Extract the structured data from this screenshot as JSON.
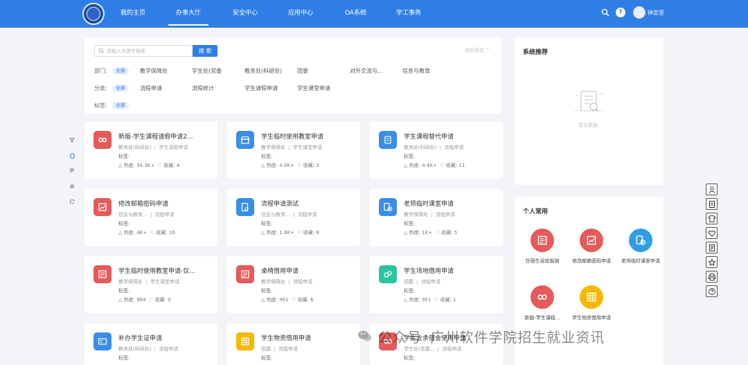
{
  "nav": {
    "items": [
      "我的主页",
      "办事大厅",
      "安全中心",
      "应用中心",
      "OA系统",
      "学工事务"
    ],
    "active_index": 1,
    "help_symbol": "?",
    "user_name": "钟志坚"
  },
  "left_icons": [
    "filter-icon",
    "home-icon",
    "list-icon",
    "hash-icon",
    "refresh-icon"
  ],
  "filter": {
    "search_placeholder": "请输入关键字搜索",
    "search_button": "搜 索",
    "collapse_link": "收起筛选 ^",
    "rows": [
      {
        "label": "部门:",
        "all": "全部",
        "options": [
          "教学保障处",
          "学生处(党委",
          "教务处(科研处)",
          "团委",
          "对外交流与...",
          "信息与教育"
        ]
      },
      {
        "label": "分类:",
        "all": "全部",
        "options": [
          "流程申请",
          "流程统计",
          "学生请假申请",
          "学生课堂申请"
        ]
      },
      {
        "label": "标签:",
        "all": "全部",
        "options": []
      }
    ]
  },
  "cards": [
    {
      "title": "新版-学生课程请假申请2...",
      "dept": "教务处(科研处)",
      "category": "学生请假申请",
      "tags_label": "标签:",
      "heat_label": "热度:",
      "heat": "54.3K+",
      "fav_label": "收藏:",
      "fav": "4",
      "color": "#e55a5a",
      "icon": "infinity-icon"
    },
    {
      "title": "学生临时使用教室申请",
      "dept": "教学保障处",
      "category": "学生课堂申请",
      "tags_label": "标签:",
      "heat_label": "热度:",
      "heat": "4.9K+",
      "fav_label": "收藏:",
      "fav": "3",
      "color": "#3a8ee6",
      "icon": "store-icon"
    },
    {
      "title": "学生课程替代申请",
      "dept": "教务处(科研处)",
      "category": "流程申请",
      "tags_label": "标签:",
      "heat_label": "热度:",
      "heat": "4.4K+",
      "fav_label": "收藏:",
      "fav": "11",
      "color": "#3a8ee6",
      "icon": "hand-icon"
    },
    {
      "title": "修改邮箱密码申请",
      "dept": "信息与教育...",
      "category": "流程申请",
      "tags_label": "标签:",
      "heat_label": "热度:",
      "heat": "4K+",
      "fav_label": "收藏:",
      "fav": "16",
      "color": "#e55a5a",
      "icon": "chart-icon"
    },
    {
      "title": "流程申请测试",
      "dept": "信息与教育...",
      "category": "流程申请",
      "tags_label": "标签:",
      "heat_label": "热度:",
      "heat": "1.8K+",
      "fav_label": "收藏:",
      "fav": "8",
      "color": "#3a8ee6",
      "icon": "doc-search-icon"
    },
    {
      "title": "老师临时课室申请",
      "dept": "教学保障处",
      "category": "流程申请",
      "tags_label": "标签:",
      "heat_label": "热度:",
      "heat": "1K+",
      "fav_label": "收藏:",
      "fav": "5",
      "color": "#3a8ee6",
      "icon": "doc-clock-icon"
    },
    {
      "title": "学生临时使用教室申请-仅...",
      "dept": "教学保障处",
      "category": "学生课堂申请",
      "tags_label": "标签:",
      "heat_label": "热度:",
      "heat": "984",
      "fav_label": "收藏:",
      "fav": "0",
      "color": "#e55a5a",
      "icon": "form-icon"
    },
    {
      "title": "桌椅借用申请",
      "dept": "教学保障处",
      "category": "流程申请",
      "tags_label": "标签:",
      "heat_label": "热度:",
      "heat": "961",
      "fav_label": "收藏:",
      "fav": "6",
      "color": "#e55a5a",
      "icon": "form-icon"
    },
    {
      "title": "学生场地借用申请",
      "dept": "团委",
      "category": "流程申请",
      "tags_label": "标签:",
      "heat_label": "热度:",
      "heat": "951",
      "fav_label": "收藏:",
      "fav": "1",
      "color": "#2bc4a0",
      "icon": "venue-icon"
    },
    {
      "title": "补办学生证申请",
      "dept": "教务处(科研处)",
      "category": "流程申请",
      "tags_label": "标签:",
      "heat_label": "",
      "heat": "",
      "fav_label": "",
      "fav": "",
      "color": "#3a8ee6",
      "icon": "card-icon"
    },
    {
      "title": "学生物资借用申请",
      "dept": "团委",
      "category": "流程申请",
      "tags_label": "标签:",
      "heat_label": "",
      "heat": "",
      "fav_label": "",
      "fav": "",
      "color": "#f5b800",
      "icon": "grid-icon"
    },
    {
      "title": "学生业余宿舍使用申请",
      "dept": "学生处(党委...",
      "category": "流程申请",
      "tags_label": "标签:",
      "heat_label": "",
      "heat": "",
      "fav_label": "",
      "fav": "",
      "color": "#e55a5a",
      "icon": "infinity-icon"
    }
  ],
  "recommend": {
    "title": "系统推荐",
    "empty_text": "暂无数据"
  },
  "common": {
    "title": "个人常用",
    "items": [
      {
        "label": "住宿生返校报销",
        "color": "#e55a5a",
        "icon": "form-icon"
      },
      {
        "label": "修改邮箱密码申请",
        "color": "#e55a5a",
        "icon": "chart-icon"
      },
      {
        "label": "老师临时课室申请",
        "color": "#2f9ee6",
        "icon": "doc-clock-icon"
      },
      {
        "label": "新版-学生课程...",
        "color": "#e55a5a",
        "icon": "infinity-icon"
      },
      {
        "label": "学生物资借用申请",
        "color": "#f5b800",
        "icon": "grid-icon"
      }
    ]
  },
  "float_toolbar": [
    "user-icon",
    "doc-icon",
    "shirt-icon",
    "heart-icon",
    "note-icon",
    "star-icon",
    "print-icon",
    "help-icon"
  ],
  "watermark": {
    "prefix": "公众号",
    "dot": "·",
    "name": "广州软件学院招生就业资讯"
  }
}
